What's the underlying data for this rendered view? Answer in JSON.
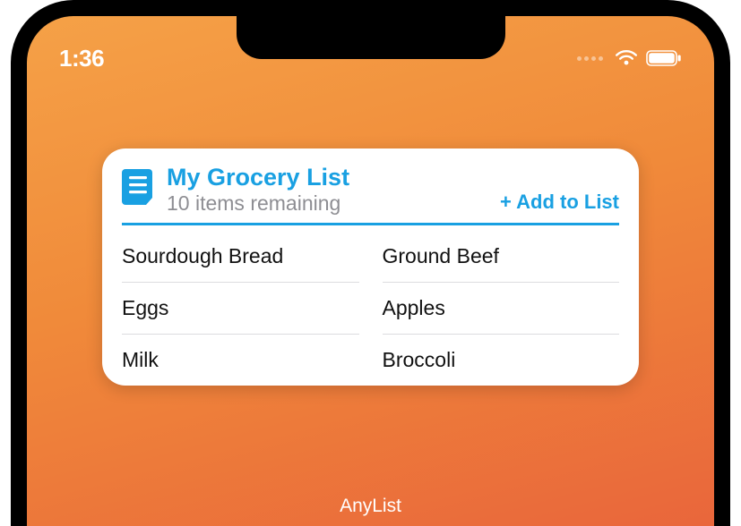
{
  "status": {
    "time": "1:36"
  },
  "widget": {
    "title": "My Grocery List",
    "subtitle": "10 items remaining",
    "add_label": "+ Add to List",
    "items": [
      "Sourdough Bread",
      "Ground Beef",
      "Eggs",
      "Apples",
      "Milk",
      "Broccoli"
    ]
  },
  "app_label": "AnyList",
  "colors": {
    "accent": "#19a0e2",
    "subtitle": "#8e8e93",
    "gradient_top": "#f5a147",
    "gradient_bottom": "#e9663b"
  }
}
